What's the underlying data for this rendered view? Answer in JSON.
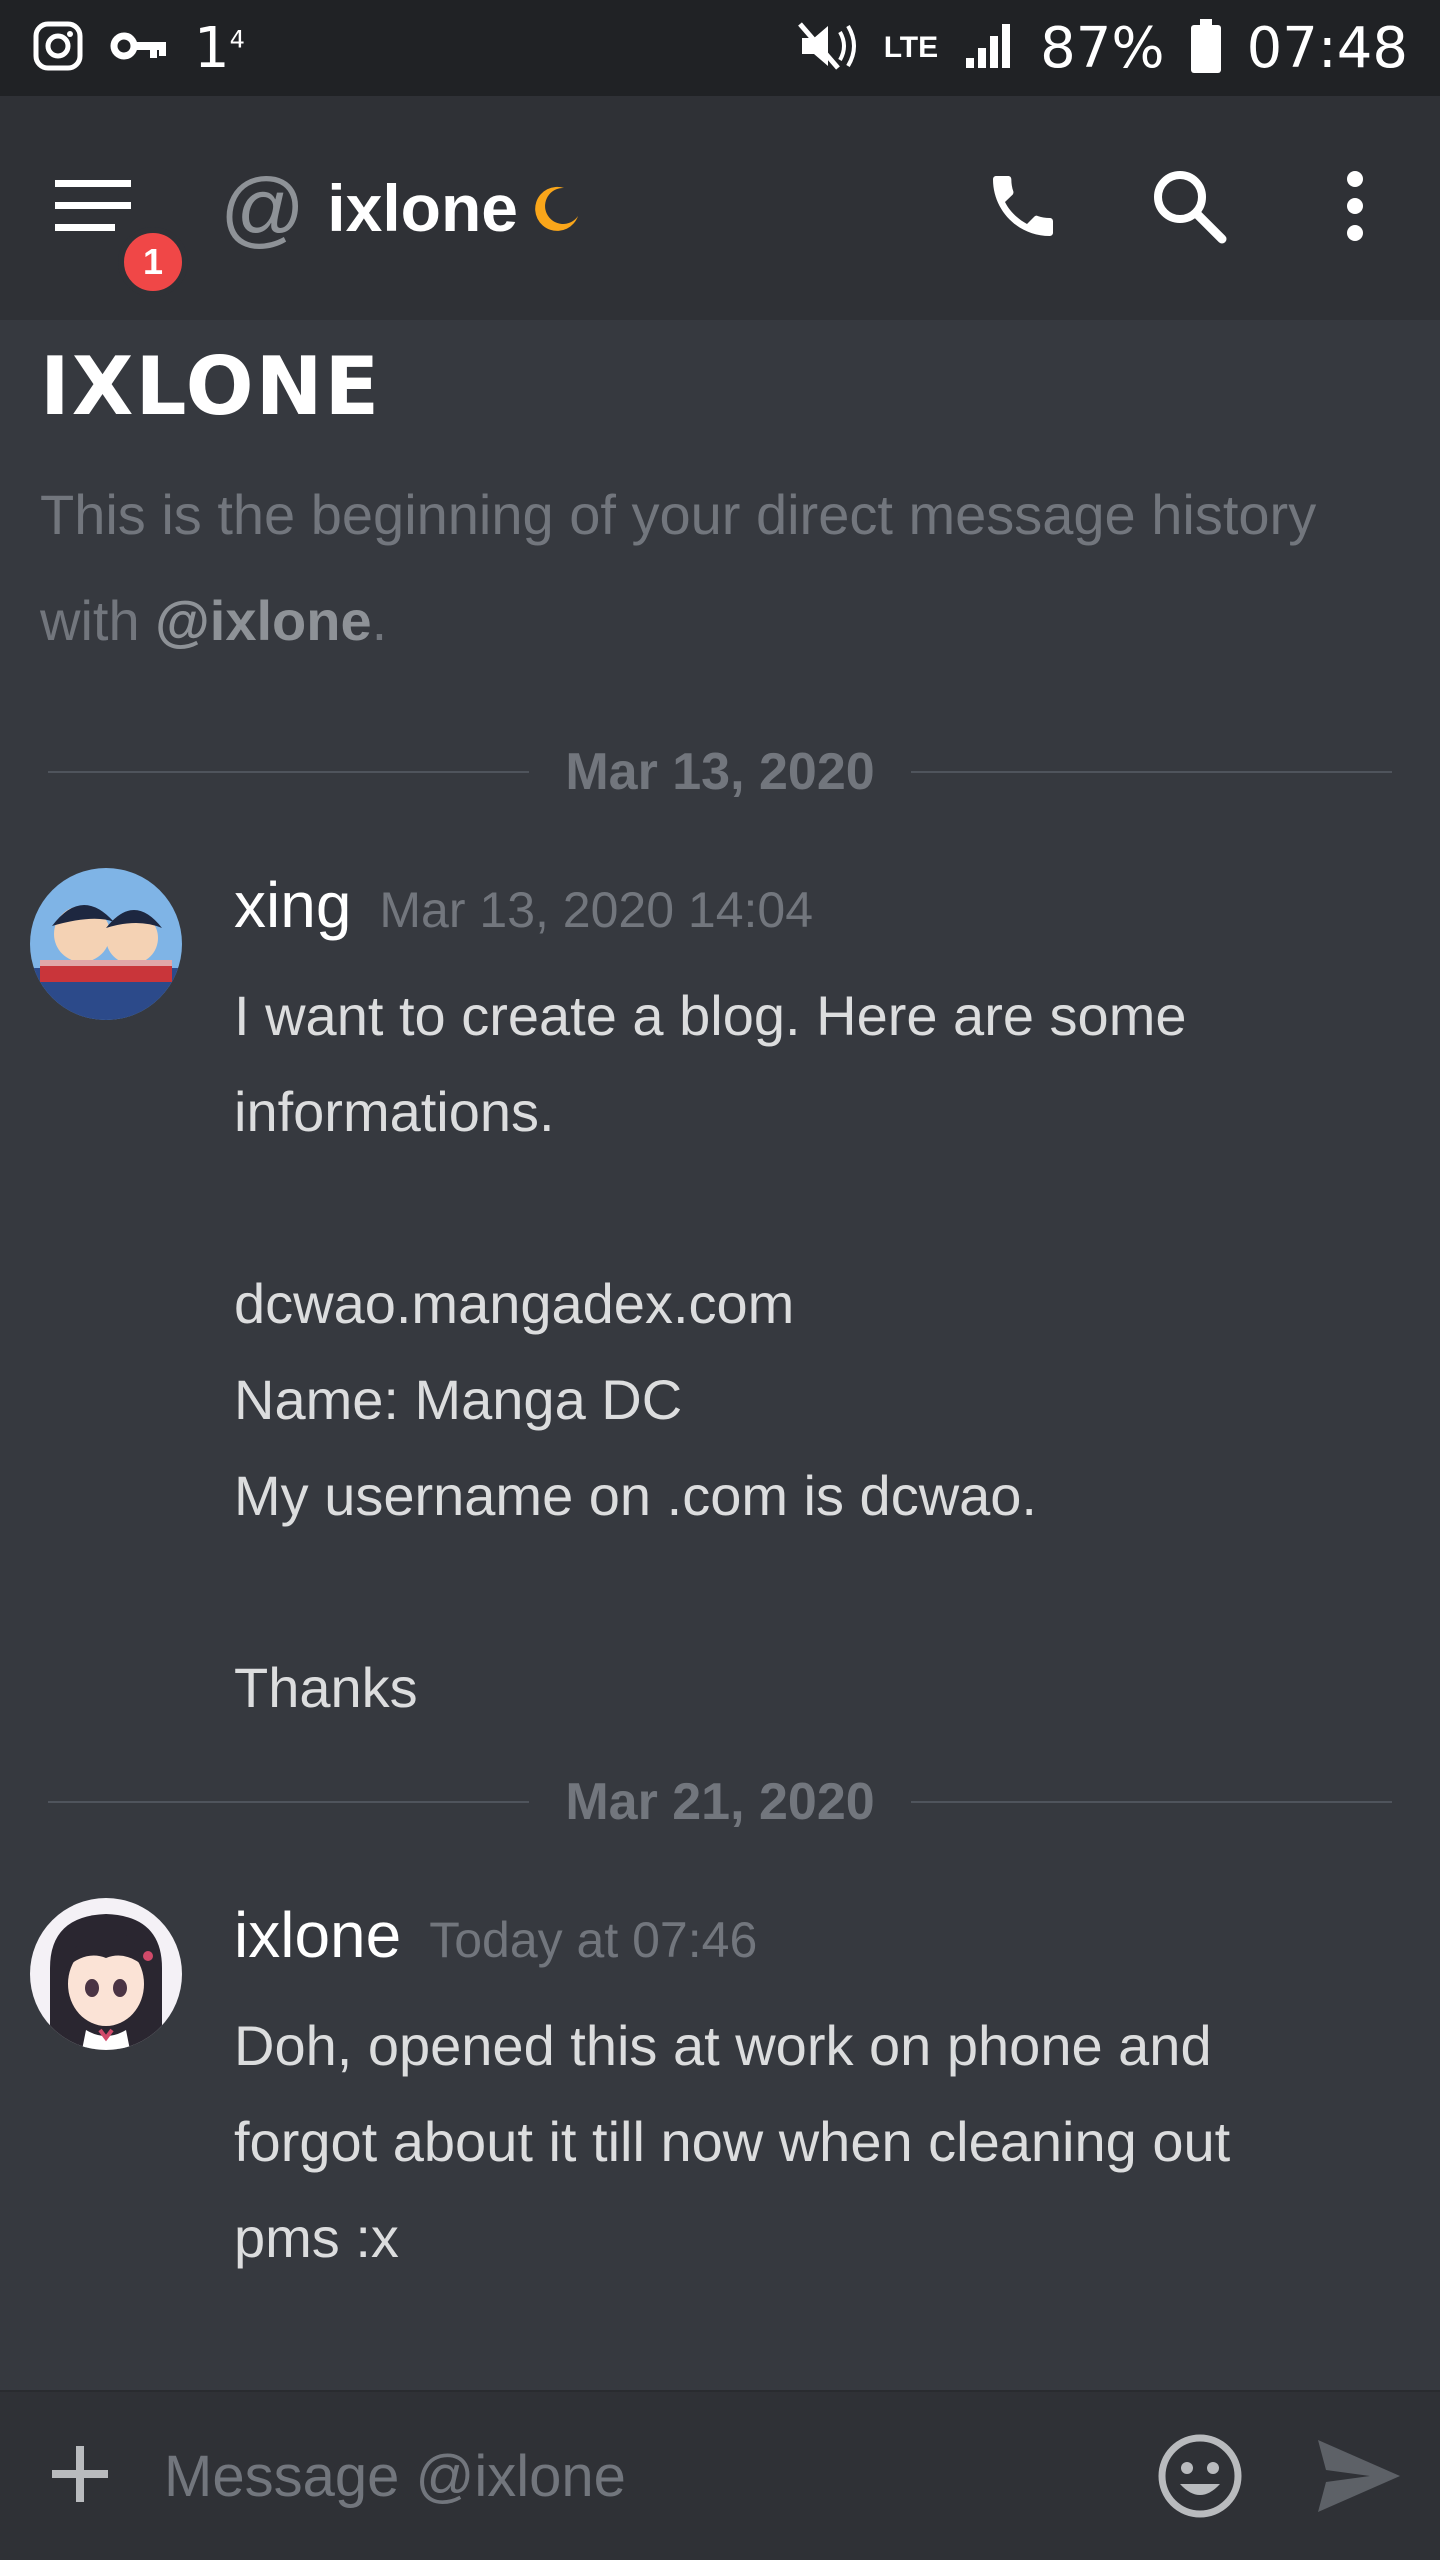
{
  "status_bar": {
    "left_text": "1",
    "left_super": "4",
    "network": "LTE",
    "battery": "87%",
    "time": "07:48"
  },
  "header": {
    "title": "ixlone",
    "badge": "1",
    "at_symbol": "@"
  },
  "intro": {
    "title": "IXLONE",
    "text_before": "This is the beginning of your direct message history with ",
    "mention": "@ixlone",
    "text_after": "."
  },
  "dividers": [
    "Mar 13, 2020",
    "Mar 21, 2020"
  ],
  "messages": [
    {
      "username": "xing",
      "timestamp": "Mar 13, 2020 14:04",
      "lines": [
        "I want to create a blog. Here are some",
        "informations.",
        "",
        "dcwao.mangadex.com",
        "Name: Manga DC",
        "My username on .com is dcwao.",
        "",
        "Thanks"
      ]
    },
    {
      "username": "ixlone",
      "timestamp": "Today at 07:46",
      "lines": [
        "Doh, opened this at work on phone and",
        "forgot about it till now when cleaning out",
        "pms :x"
      ]
    }
  ],
  "composer": {
    "placeholder": "Message @ixlone"
  },
  "colors": {
    "background": "#36393f",
    "header": "#2f3136",
    "statusbar": "#202225",
    "badge": "#f04747",
    "moon": "#faa61a",
    "muted": "#72767d"
  }
}
